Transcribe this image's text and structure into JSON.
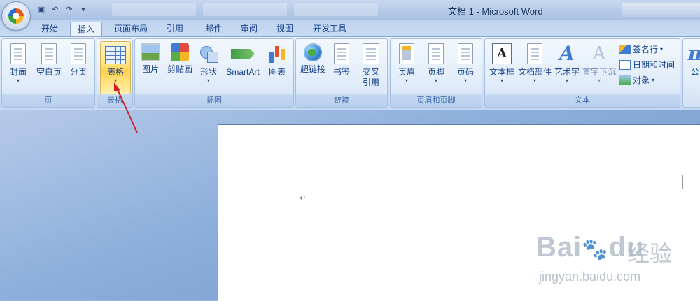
{
  "window": {
    "title": "文档 1 - Microsoft Word"
  },
  "tabs": [
    "开始",
    "插入",
    "页面布局",
    "引用",
    "邮件",
    "审阅",
    "视图",
    "开发工具"
  ],
  "active_tab": "插入",
  "groups": {
    "pages": {
      "label": "页",
      "buttons": [
        "封面",
        "空白页",
        "分页"
      ]
    },
    "tables": {
      "label": "表格",
      "buttons": [
        "表格"
      ]
    },
    "illustrations": {
      "label": "插图",
      "buttons": [
        "图片",
        "剪贴画",
        "形状",
        "SmartArt",
        "图表"
      ]
    },
    "links": {
      "label": "链接",
      "buttons": [
        "超链接",
        "书签",
        "交叉",
        "引用"
      ]
    },
    "header_footer": {
      "label": "页眉和页脚",
      "buttons": [
        "页眉",
        "页脚",
        "页码"
      ]
    },
    "text": {
      "label": "文本",
      "buttons": [
        "文本框",
        "文档部件",
        "艺术字",
        "首字下沉"
      ],
      "small": [
        "签名行",
        "日期和时间",
        "对象"
      ]
    },
    "symbols": {
      "partial_label": "公"
    }
  },
  "document": {
    "paragraph_mark": "↵"
  },
  "watermark": {
    "brand": "Bai",
    "brand2": "du",
    "cn": "经验",
    "url": "jingyan.baidu.com"
  },
  "colors": {
    "accent": "#15428b",
    "highlight": "#ffd24c",
    "arrow": "#d0202a"
  }
}
